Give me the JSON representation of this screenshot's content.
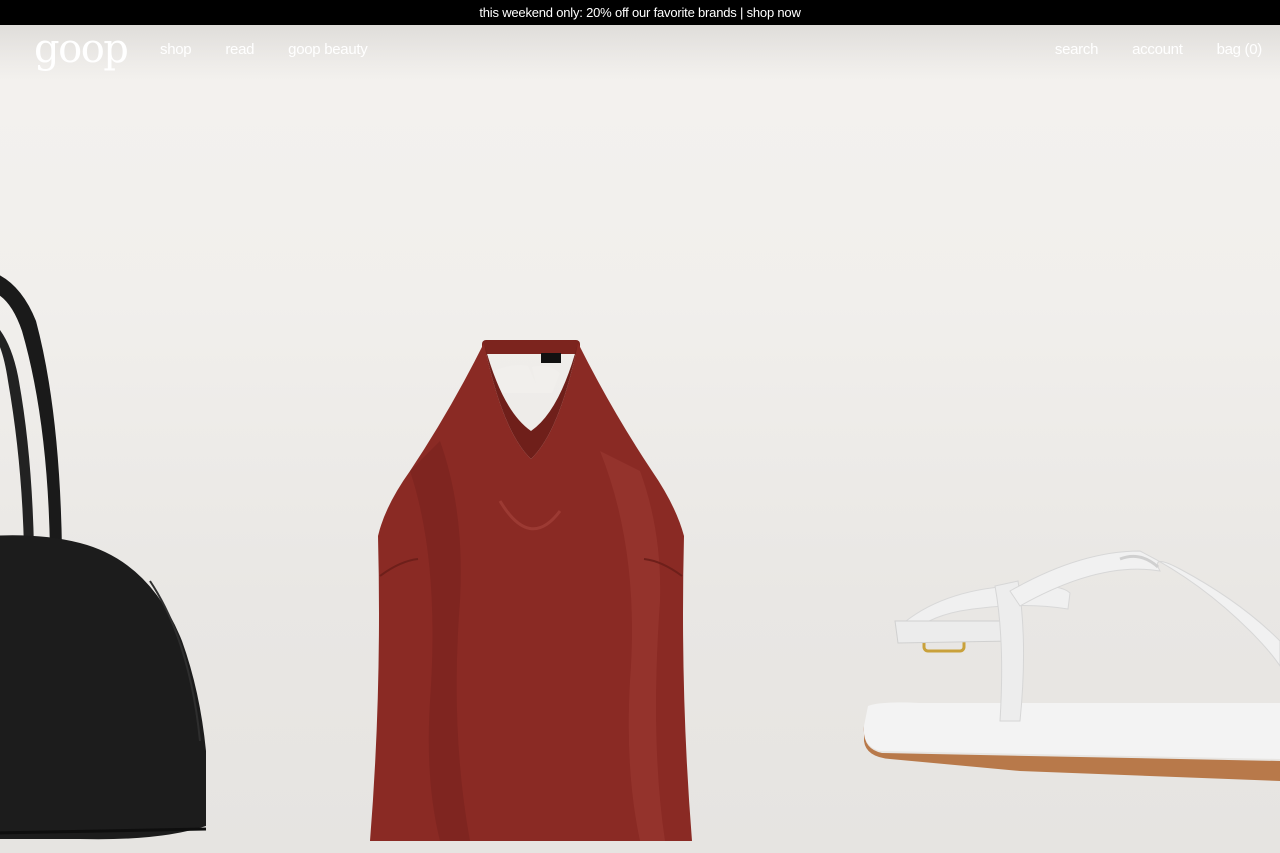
{
  "promo": {
    "text": "this weekend only: 20% off our favorite brands | shop now"
  },
  "header": {
    "logo": "goop",
    "nav_left": [
      "shop",
      "read",
      "goop beauty"
    ],
    "nav_right": {
      "search": "search",
      "account": "account",
      "bag": "bag (0)"
    }
  },
  "hero": {
    "products": [
      "black-leather-handbag",
      "red-satin-halter-top",
      "white-leather-thong-sandal"
    ],
    "colors": {
      "background": "#eeece9",
      "handbag": "#1c1c1c",
      "top": "#8a2a24",
      "sandal": "#f2f2f2",
      "sole": "#b8794a"
    }
  }
}
